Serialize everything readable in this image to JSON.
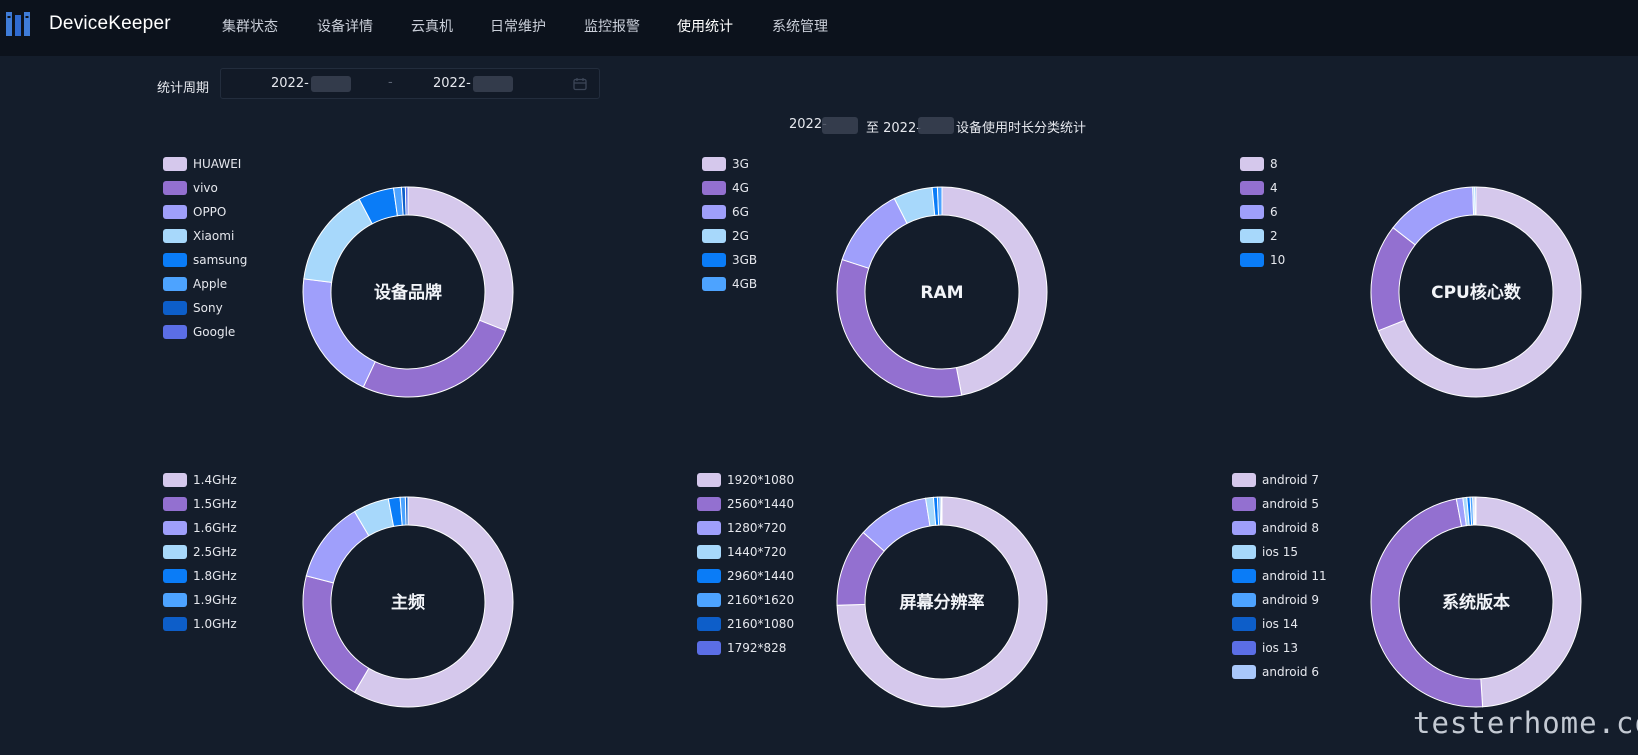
{
  "app": {
    "brand": "DeviceKeeper",
    "logo_icon": "bookshelf-icon"
  },
  "nav": {
    "items": [
      {
        "label": "集群状态",
        "active": false
      },
      {
        "label": "设备详情",
        "active": false
      },
      {
        "label": "云真机",
        "active": false
      },
      {
        "label": "日常维护",
        "active": false
      },
      {
        "label": "监控报警",
        "active": false
      },
      {
        "label": "使用统计",
        "active": true
      },
      {
        "label": "系统管理",
        "active": false
      }
    ]
  },
  "filter": {
    "period_label": "统计周期",
    "start_date": "2022-",
    "end_date": "2022-",
    "calendar_icon": "calendar-icon"
  },
  "report": {
    "title_start": "2022-",
    "title_mid": "至 2022-",
    "title_end": "设备使用时长分类统计"
  },
  "colors": [
    "#d5c8ec",
    "#9370d0",
    "#9f9ffb",
    "#a7d8fb",
    "#0a7cf7",
    "#4da3ff",
    "#0d5ec9",
    "#5b6ee6",
    "#a9c8fb"
  ],
  "charts": [
    {
      "type": "donut",
      "title": "设备品牌",
      "legend": [
        "HUAWEI",
        "vivo",
        "OPPO",
        "Xiaomi",
        "samsung",
        "Apple",
        "Sony",
        "Google"
      ],
      "values": [
        31.0,
        26.0,
        20.0,
        15.3,
        5.5,
        1.2,
        0.6,
        0.4
      ]
    },
    {
      "type": "donut",
      "title": "RAM",
      "legend": [
        "3G",
        "4G",
        "6G",
        "2G",
        "3GB",
        "4GB"
      ],
      "values": [
        47.0,
        33.0,
        12.5,
        6.0,
        0.8,
        0.7
      ]
    },
    {
      "type": "donut",
      "title": "CPU核心数",
      "legend": [
        "8",
        "4",
        "6",
        "2",
        "10"
      ],
      "values": [
        69.0,
        16.5,
        14.0,
        0.3,
        0.2
      ]
    },
    {
      "type": "donut",
      "title": "主频",
      "legend": [
        "1.4GHz",
        "1.5GHz",
        "1.6GHz",
        "2.5GHz",
        "1.8GHz",
        "1.9GHz",
        "1.0GHz"
      ],
      "values": [
        58.5,
        20.5,
        12.5,
        5.5,
        1.8,
        0.8,
        0.4
      ]
    },
    {
      "type": "donut",
      "title": "屏幕分辨率",
      "legend": [
        "1920*1080",
        "2560*1440",
        "1280*720",
        "1440*720",
        "2960*1440",
        "2160*1620",
        "2160*1080",
        "1792*828"
      ],
      "values": [
        74.5,
        12.0,
        11.0,
        1.2,
        0.6,
        0.4,
        0.2,
        0.1
      ]
    },
    {
      "type": "donut",
      "title": "系统版本",
      "legend": [
        "android 7",
        "android 5",
        "android 8",
        "ios 15",
        "android 11",
        "android 9",
        "ios 14",
        "ios 13",
        "android 6"
      ],
      "values": [
        49.0,
        48.0,
        1.0,
        0.6,
        0.5,
        0.4,
        0.2,
        0.2,
        0.1
      ]
    }
  ],
  "watermark": "testerhome.com"
}
